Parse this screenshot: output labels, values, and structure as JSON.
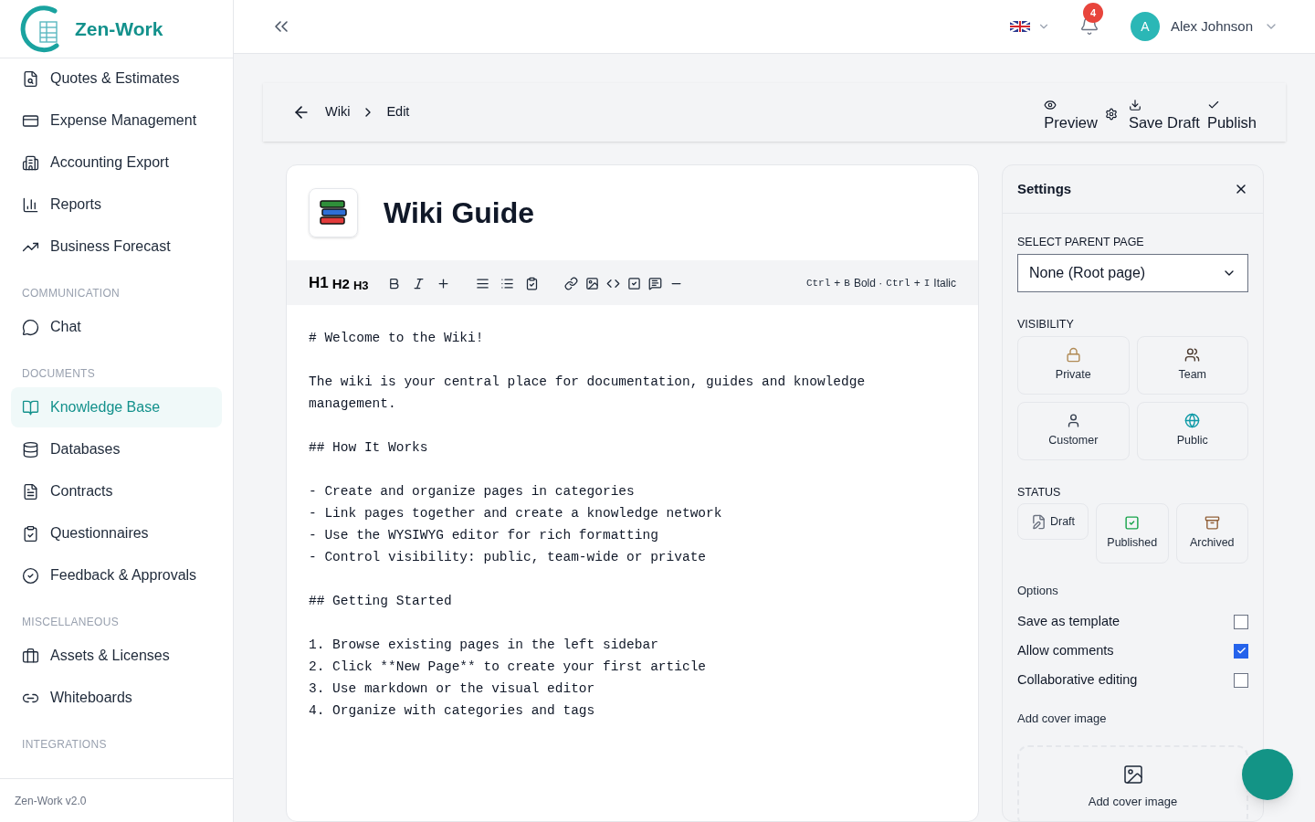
{
  "brand": {
    "name": "Zen-Work"
  },
  "sidebar": {
    "entries": [
      {
        "kind": "item",
        "label": "Quotes & Estimates",
        "selected": false
      },
      {
        "kind": "item",
        "label": "Expense Management",
        "selected": false
      },
      {
        "kind": "item",
        "label": "Accounting Export",
        "selected": false
      },
      {
        "kind": "item",
        "label": "Reports",
        "selected": false
      },
      {
        "kind": "item",
        "label": "Business Forecast",
        "selected": false
      },
      {
        "kind": "heading",
        "label": "COMMUNICATION"
      },
      {
        "kind": "item",
        "label": "Chat",
        "selected": false
      },
      {
        "kind": "heading",
        "label": "DOCUMENTS"
      },
      {
        "kind": "item",
        "label": "Knowledge Base",
        "selected": true
      },
      {
        "kind": "item",
        "label": "Databases",
        "selected": false
      },
      {
        "kind": "item",
        "label": "Contracts",
        "selected": false
      },
      {
        "kind": "item",
        "label": "Questionnaires",
        "selected": false
      },
      {
        "kind": "item",
        "label": "Feedback & Approvals",
        "selected": false
      },
      {
        "kind": "heading",
        "label": "MISCELLANEOUS"
      },
      {
        "kind": "item",
        "label": "Assets & Licenses",
        "selected": false
      },
      {
        "kind": "item",
        "label": "Whiteboards",
        "selected": false
      },
      {
        "kind": "heading",
        "label": "INTEGRATIONS"
      }
    ],
    "version": "Zen-Work v2.0"
  },
  "header": {
    "notifications": "4",
    "user": {
      "initial": "A",
      "name": "Alex Johnson"
    }
  },
  "breadcrumb": [
    "Wiki",
    "Edit"
  ],
  "actions": {
    "preview": "Preview",
    "save": "Save Draft",
    "publish": "Publish"
  },
  "editor": {
    "title": "Wiki Guide",
    "headings": [
      "H1",
      "H2",
      "H3"
    ],
    "hint": [
      {
        "kind": "kbd",
        "text": "Ctrl"
      },
      {
        "kind": "text",
        "text": "+"
      },
      {
        "kind": "kbd",
        "text": "B"
      },
      {
        "kind": "text",
        "text": "Bold ·"
      },
      {
        "kind": "kbd",
        "text": "Ctrl"
      },
      {
        "kind": "text",
        "text": "+"
      },
      {
        "kind": "kbd",
        "text": "I"
      },
      {
        "kind": "text",
        "text": "Italic"
      }
    ],
    "blocks": [
      [
        "# Welcome to the Wiki!"
      ],
      [
        "The wiki is your central place for documentation, guides and knowledge",
        "management."
      ],
      [
        "## How It Works"
      ],
      [
        "- Create and organize pages in categories",
        "- Link pages together and create a knowledge network",
        "- Use the WYSIWYG editor for rich formatting",
        "- Control visibility: public, team-wide or private"
      ],
      [
        "## Getting Started"
      ],
      [
        "1. Browse existing pages in the left sidebar",
        "2. Click **New Page** to create your first article",
        "3. Use markdown or the visual editor",
        "4. Organize with categories and tags"
      ]
    ]
  },
  "settings": {
    "title": "Settings",
    "parent_label": "SELECT PARENT PAGE",
    "parent_value": "None (Root page)",
    "visibility_label": "VISIBILITY",
    "visibility": [
      {
        "label": "Private",
        "selected": false
      },
      {
        "label": "Team",
        "selected": false
      },
      {
        "label": "Customer",
        "selected": false
      },
      {
        "label": "Public",
        "selected": false
      }
    ],
    "status_label": "STATUS",
    "status": [
      {
        "label": "Draft",
        "selected": false
      },
      {
        "label": "Published",
        "selected": false
      },
      {
        "label": "Archived",
        "selected": false
      }
    ],
    "options_label": "Options",
    "options": [
      {
        "label": "Save as template",
        "checked": false
      },
      {
        "label": "Allow comments",
        "checked": true
      },
      {
        "label": "Collaborative editing",
        "checked": false
      }
    ],
    "cover_label": "Add cover image",
    "cover_button": "Add cover image"
  }
}
